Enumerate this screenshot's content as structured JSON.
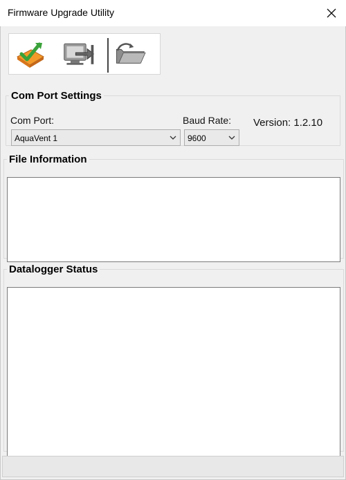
{
  "window": {
    "title": "Firmware Upgrade Utility"
  },
  "toolbar": {
    "buttons": [
      {
        "icon": "check-upload-icon"
      },
      {
        "icon": "monitor-transfer-icon"
      },
      {
        "icon": "open-folder-icon"
      }
    ]
  },
  "com_port_settings": {
    "legend": "Com Port Settings",
    "com_port_label": "Com Port:",
    "com_port_value": "AquaVent 1",
    "baud_rate_label": "Baud Rate:",
    "baud_rate_value": "9600",
    "version": "Version: 1.2.10"
  },
  "file_information": {
    "legend": "File Information"
  },
  "datalogger_status": {
    "legend": "Datalogger Status"
  }
}
